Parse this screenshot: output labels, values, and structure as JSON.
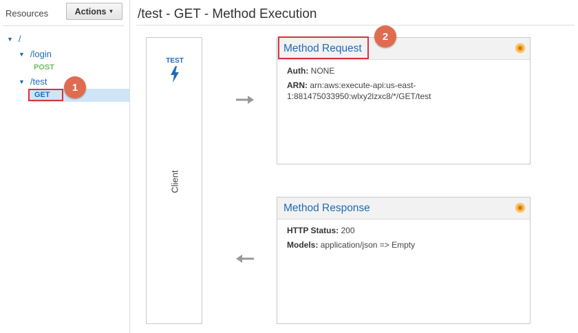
{
  "sidebar": {
    "title": "Resources",
    "actions_label": "Actions",
    "tree": {
      "root": "/",
      "login": "/login",
      "login_method": "POST",
      "test": "/test",
      "test_method": "GET"
    }
  },
  "badges": {
    "one": "1",
    "two": "2"
  },
  "page": {
    "title": "/test - GET - Method Execution"
  },
  "client": {
    "test_label": "TEST",
    "label": "Client",
    "test_icon": "lightning-bolt-icon"
  },
  "method_request": {
    "title": "Method Request",
    "auth_label": "Auth:",
    "auth_value": "NONE",
    "arn_label": "ARN:",
    "arn_value": "arn:aws:execute-api:us-east-1:881475033950:wlxy2lzxc8/*/GET/test",
    "arn_line1": "arn:aws:execute-api:us-east-",
    "arn_line2": "1:881475033950:wlxy2lzxc8/*/GET/test"
  },
  "method_response": {
    "title": "Method Response",
    "status_label": "HTTP Status:",
    "status_value": "200",
    "models_label": "Models:",
    "models_value": "application/json => Empty"
  },
  "colors": {
    "link": "#1f6bb5",
    "highlight_red": "#d9303f",
    "badge": "#e06c50",
    "post_green": "#6cbf5e",
    "selected_bg": "#cfe5f7"
  }
}
